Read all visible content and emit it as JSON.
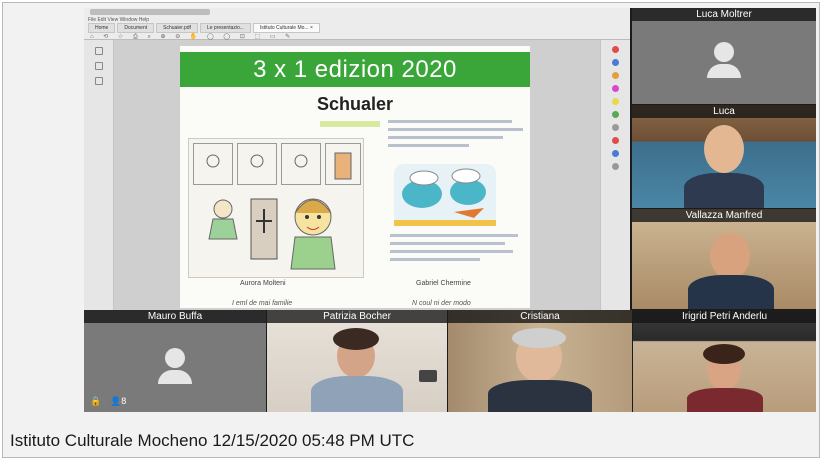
{
  "screen_share": {
    "browser_menu": "File  Edit  View  Window  Help",
    "tabs": [
      "Home",
      "Document",
      "Schuaier.pdf",
      "Le presentazio...",
      "Istituto Culturale Mo... ×"
    ],
    "toolbar": "⌂ ⟲ ☆ ⎙ ⌕   ⊕ ⊖   ✋ ◯ ◯   ⊡ ⬚ ▭ ✎",
    "document": {
      "banner": "3 x 1 edizion 2020",
      "heading": "Schualer",
      "caption_left": "Aurora Molteni",
      "caption_right": "Gabriel Chermine",
      "caption_left_2": "I eml de mai familie",
      "caption_right_2": "N coul ni der modo"
    }
  },
  "participants": [
    {
      "name": "Luca Moltrer",
      "video": false
    },
    {
      "name": "Luca",
      "video": true
    },
    {
      "name": "Vallazza Manfred",
      "video": true
    },
    {
      "name": "Mauro Buffa",
      "video": false
    },
    {
      "name": "Patrizia Bocher",
      "video": true
    },
    {
      "name": "Cristiana",
      "video": true
    },
    {
      "name": "Irigrid Petri Anderlu",
      "video": true
    }
  ],
  "tile_icons": {
    "lock": "lock-icon",
    "participants_count": "8"
  },
  "footer_caption": "Istituto Culturale Mocheno 12/15/2020 05:48 PM UTC",
  "colors": {
    "banner_green": "#3aa63a",
    "call_background": "#1b1b1b",
    "avatar_tile": "#7a7a7a"
  }
}
